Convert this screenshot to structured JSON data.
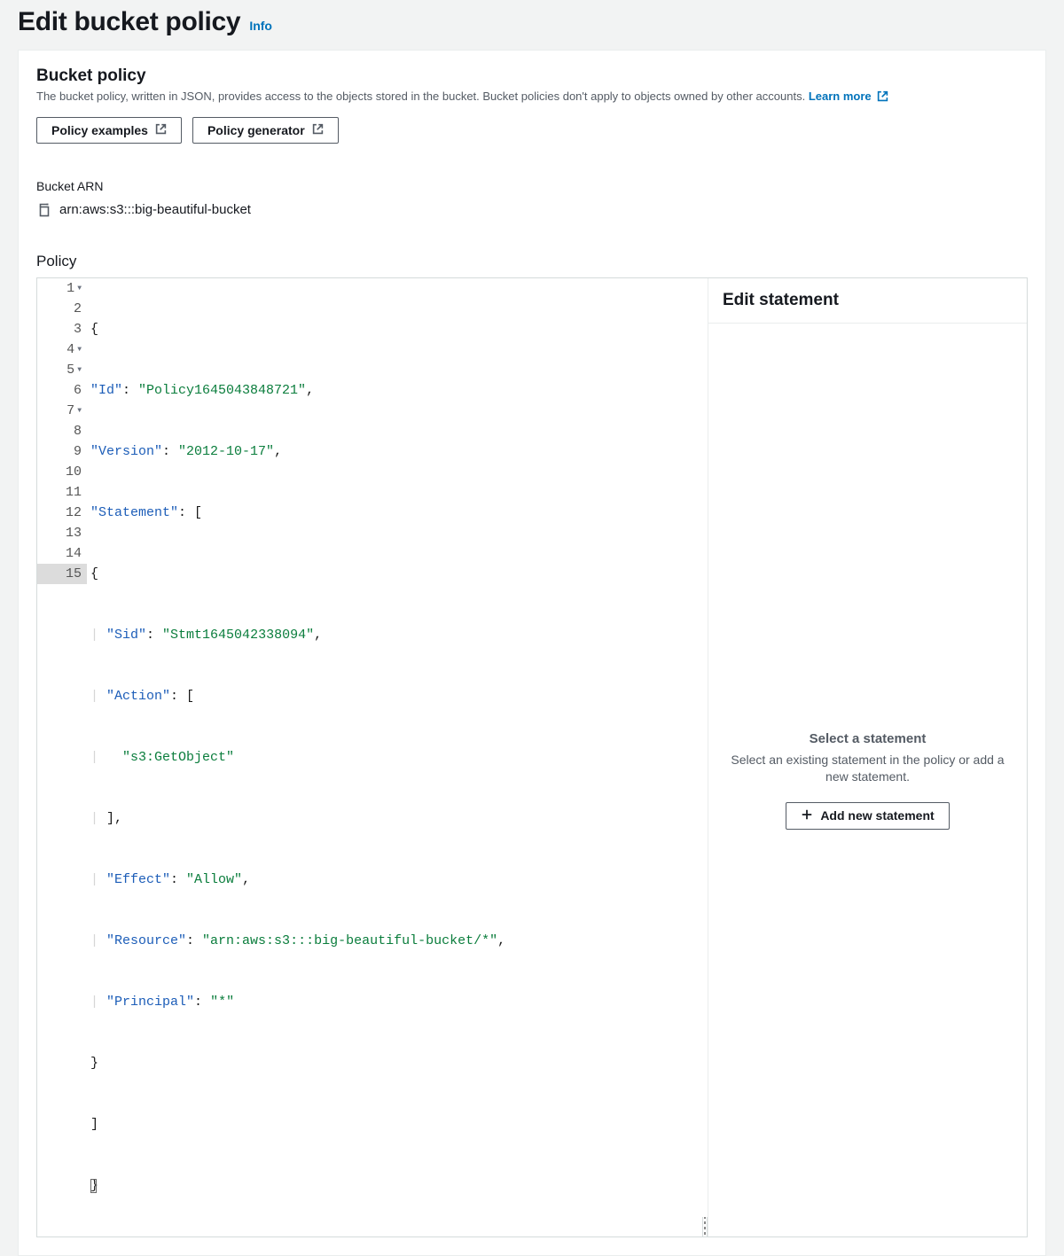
{
  "page": {
    "title": "Edit bucket policy",
    "info": "Info"
  },
  "panel": {
    "heading": "Bucket policy",
    "description": "The bucket policy, written in JSON, provides access to the objects stored in the bucket. Bucket policies don't apply to objects owned by other accounts. ",
    "learn_more": "Learn more",
    "btn_examples": "Policy examples",
    "btn_generator": "Policy generator"
  },
  "arn": {
    "label": "Bucket ARN",
    "value": "arn:aws:s3:::big-beautiful-bucket"
  },
  "policy": {
    "label": "Policy",
    "lines": {
      "l1": "{",
      "l2_k": "\"Id\"",
      "l2_v": "\"Policy1645043848721\"",
      "l3_k": "\"Version\"",
      "l3_v": "\"2012-10-17\"",
      "l4_k": "\"Statement\"",
      "l5": "{",
      "l6_k": "\"Sid\"",
      "l6_v": "\"Stmt1645042338094\"",
      "l7_k": "\"Action\"",
      "l8_v": "\"s3:GetObject\"",
      "l9": "],",
      "l10_k": "\"Effect\"",
      "l10_v": "\"Allow\"",
      "l11_k": "\"Resource\"",
      "l11_v": "\"arn:aws:s3:::big-beautiful-bucket/*\"",
      "l12_k": "\"Principal\"",
      "l12_v": "\"*\"",
      "l13": "}",
      "l14": "]",
      "l15": "}"
    },
    "line_numbers": {
      "n1": "1",
      "n2": "2",
      "n3": "3",
      "n4": "4",
      "n5": "5",
      "n6": "6",
      "n7": "7",
      "n8": "8",
      "n9": "9",
      "n10": "10",
      "n11": "11",
      "n12": "12",
      "n13": "13",
      "n14": "14",
      "n15": "15"
    }
  },
  "side": {
    "heading": "Edit statement",
    "select_title": "Select a statement",
    "select_desc": "Select an existing statement in the policy or add a new statement.",
    "add_btn": "Add new statement"
  }
}
